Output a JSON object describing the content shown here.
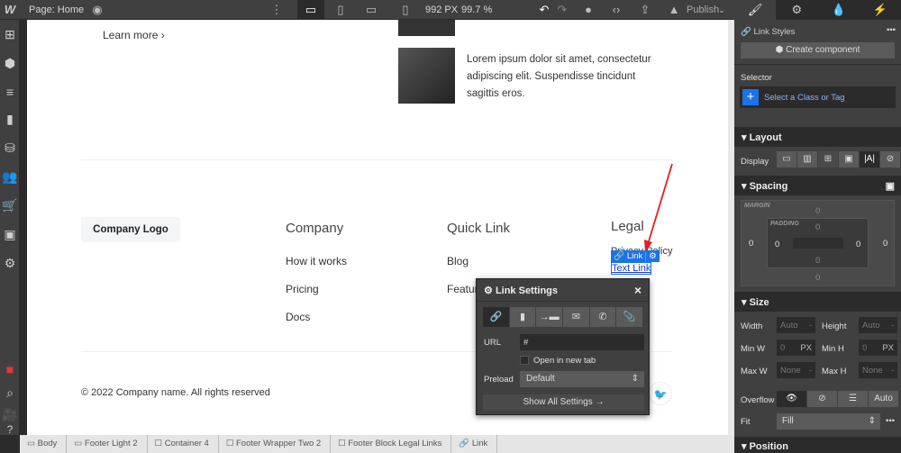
{
  "topbar": {
    "page_label": "Page: Home",
    "width": "992 PX",
    "zoom": "99.7 %",
    "publish": "Publish"
  },
  "canvas": {
    "learn_more": "Learn more",
    "lorem": "Lorem ipsum dolor sit amet, consectetur adipiscing elit. Suspendisse tincidunt sagittis eros.",
    "logo": "Company Logo",
    "cols": [
      {
        "title": "Company",
        "links": [
          "How it works",
          "Pricing",
          "Docs"
        ]
      },
      {
        "title": "Quick Link",
        "links": [
          "Blog",
          "Features"
        ]
      },
      {
        "title": "Legal",
        "links": [
          "Privacy Policy",
          "Text Link"
        ]
      }
    ],
    "copyright": "© 2022 Company name. All rights reserved",
    "badge": "Link"
  },
  "popup": {
    "title": "Link Settings",
    "url_label": "URL",
    "url_value": "#",
    "new_tab": "Open in new tab",
    "preload_label": "Preload",
    "preload_value": "Default",
    "show_all": "Show All Settings →"
  },
  "panel": {
    "link_styles": "Link Styles",
    "create_component": "Create component",
    "selector": "Selector",
    "select_class": "Select a Class or Tag",
    "layout": "Layout",
    "display": "Display",
    "spacing": "Spacing",
    "margin": "MARGIN",
    "padding": "PADDING",
    "zero": "0",
    "size": "Size",
    "width": "Width",
    "height": "Height",
    "min_w": "Min W",
    "min_h": "Min H",
    "max_w": "Max W",
    "max_h": "Max H",
    "auto": "Auto",
    "none": "None",
    "px": "PX",
    "dash": "-",
    "overflow": "Overflow",
    "overflow_auto": "Auto",
    "fit": "Fit",
    "fit_value": "Fill",
    "position": "Position"
  },
  "breadcrumbs": [
    "Body",
    "Footer Light 2",
    "Container 4",
    "Footer Wrapper Two 2",
    "Footer Block Legal Links",
    "Link"
  ],
  "colors": {
    "accent": "#1a73e8",
    "annotation": "#e02020"
  }
}
